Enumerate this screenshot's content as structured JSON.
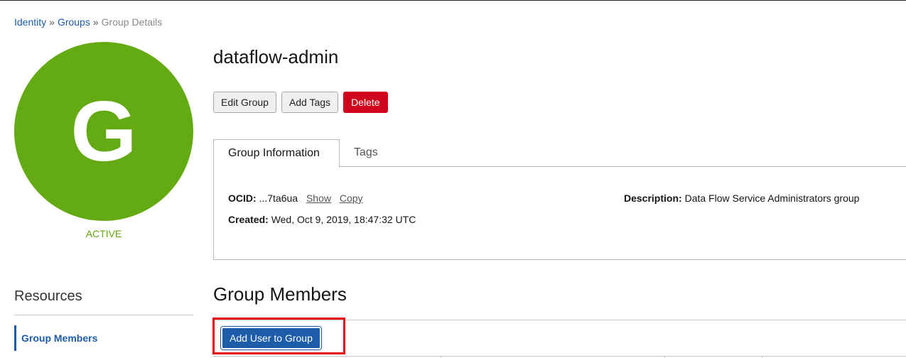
{
  "breadcrumb": {
    "items": [
      "Identity",
      "Groups"
    ],
    "separator": "»",
    "current": "Group Details"
  },
  "avatar": {
    "letter": "G",
    "color": "#64aa12"
  },
  "status": "ACTIVE",
  "resources": {
    "title": "Resources",
    "items": [
      {
        "label": "Group Members",
        "active": true
      }
    ]
  },
  "group": {
    "name": "dataflow-admin",
    "actions": {
      "edit": "Edit Group",
      "add_tags": "Add Tags",
      "delete": "Delete"
    }
  },
  "tabs": [
    {
      "label": "Group Information",
      "active": true
    },
    {
      "label": "Tags",
      "active": false
    }
  ],
  "info": {
    "ocid_label": "OCID:",
    "ocid_value": "...7ta6ua",
    "show": "Show",
    "copy": "Copy",
    "created_label": "Created:",
    "created_value": "Wed, Oct 9, 2019, 18:47:32 UTC",
    "description_label": "Description:",
    "description_value": "Data Flow Service Administrators group"
  },
  "members": {
    "title": "Group Members",
    "add_button": "Add User to Group"
  },
  "colors": {
    "link": "#1d5ca8",
    "danger": "#d0021b",
    "primary": "#1d5ca8",
    "highlight": "#e30613"
  }
}
